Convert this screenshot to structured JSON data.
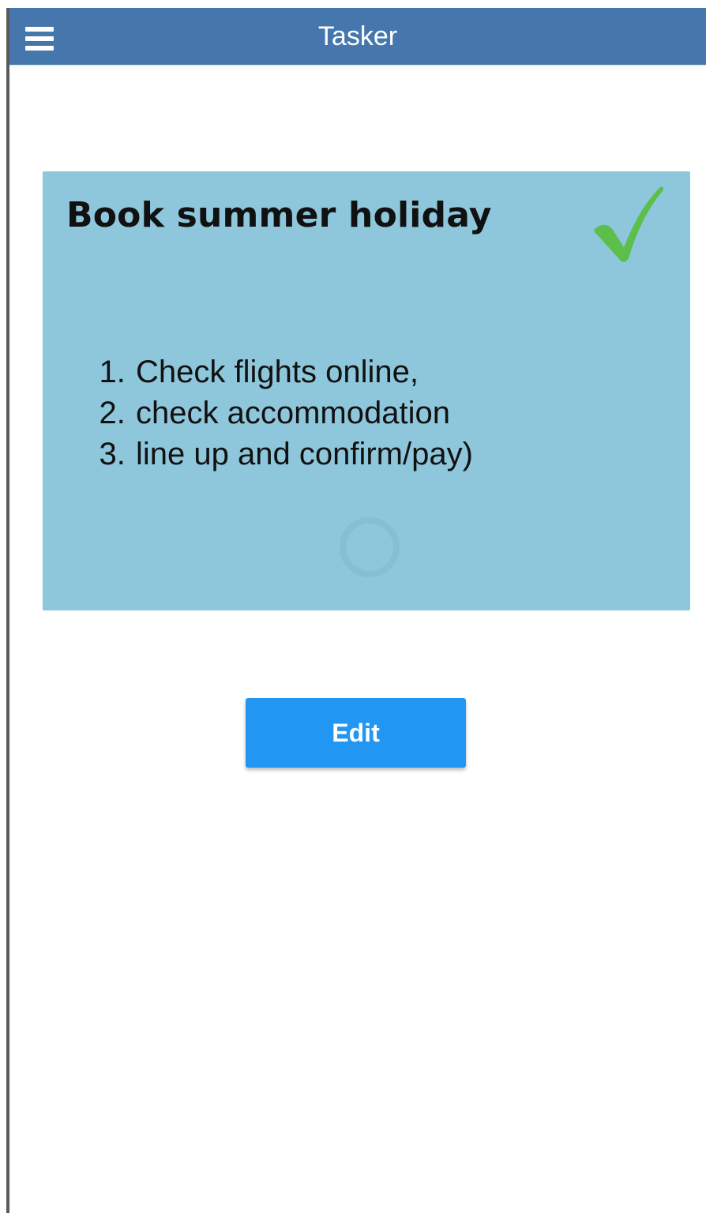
{
  "header": {
    "title": "Tasker",
    "menu_icon": "hamburger-menu-icon",
    "background_color": "#4577ad"
  },
  "task": {
    "title": "Book summer holiday",
    "status_icon": "checkmark-icon",
    "status_color": "#5cbf4a",
    "card_color": "#8ec6db",
    "steps": [
      "Check flights online,",
      "check accommodation",
      "line up and confirm/pay)"
    ]
  },
  "actions": {
    "edit_label": "Edit",
    "edit_color": "#2196f3"
  }
}
